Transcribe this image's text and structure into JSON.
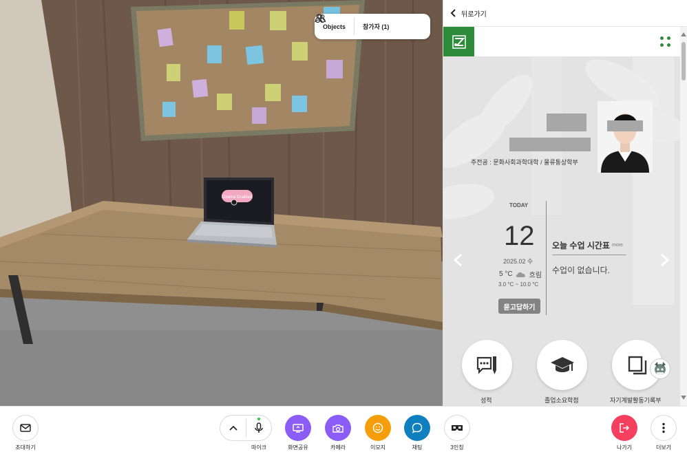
{
  "scene": {
    "objects_label": "Objects",
    "participants_label": "참가자 (1)",
    "laptop_screen_text": "Cinema Enabled"
  },
  "panel": {
    "back_label": "뒤로가기",
    "logo_icon": "university-logo-icon",
    "menu_icon": "grid-menu-icon",
    "profile": {
      "major": "주전공 : 문화사회과학대학 / 물류통상학부"
    },
    "today": {
      "label": "TODAY",
      "day": "12",
      "date": "2025.02 수",
      "temp": "5 °C",
      "weather": "흐림",
      "temp_range": "3.0 °C ~ 10.0 °C",
      "ask_button": "묻고답하기"
    },
    "schedule": {
      "title": "오늘 수업 시간표",
      "more": "more",
      "empty": "수업이 없습니다."
    },
    "quick_menu": [
      {
        "label": "성적",
        "icon": "grade-icon"
      },
      {
        "label": "졸업소요학점",
        "icon": "graduation-cap-icon"
      },
      {
        "label": "자기계발활동기록부",
        "icon": "records-icon"
      }
    ]
  },
  "toolbar": {
    "invite": "초대하기",
    "mic": "마이크",
    "screen_share": "화면공유",
    "camera": "카메라",
    "emoji": "이모지",
    "chat": "채팅",
    "view_mode": "3인칭",
    "leave": "나가기",
    "more": "더보기"
  },
  "colors": {
    "brand_green": "#2e8b3c",
    "purple": "#8b5cf6",
    "orange": "#f59e0b",
    "blue": "#0f7fbf",
    "leave_red": "#f43f5e",
    "mic_active": "#3cc34c"
  }
}
